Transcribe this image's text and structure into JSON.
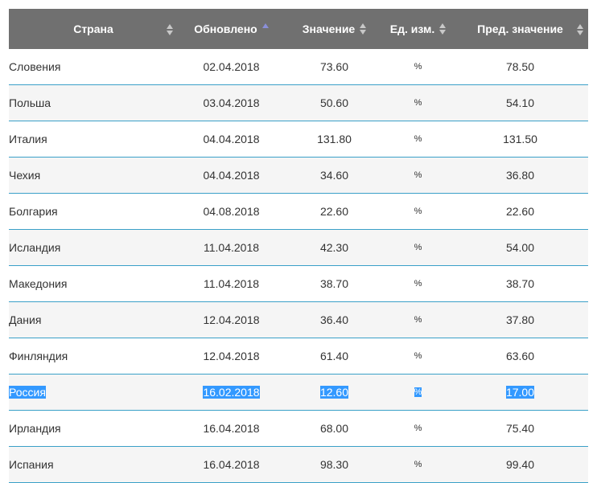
{
  "table": {
    "headers": [
      {
        "label": "Страна",
        "sort": "none"
      },
      {
        "label": "Обновлено",
        "sort": "asc"
      },
      {
        "label": "Значение",
        "sort": "none"
      },
      {
        "label": "Ед. изм.",
        "sort": "none"
      },
      {
        "label": "Пред. значение",
        "sort": "none"
      }
    ],
    "rows": [
      {
        "country": "Словения",
        "updated": "02.04.2018",
        "value": "73.60",
        "unit": "%",
        "prev": "78.50"
      },
      {
        "country": "Польша",
        "updated": "03.04.2018",
        "value": "50.60",
        "unit": "%",
        "prev": "54.10"
      },
      {
        "country": "Италия",
        "updated": "04.04.2018",
        "value": "131.80",
        "unit": "%",
        "prev": "131.50"
      },
      {
        "country": "Чехия",
        "updated": "04.04.2018",
        "value": "34.60",
        "unit": "%",
        "prev": "36.80"
      },
      {
        "country": "Болгария",
        "updated": "04.08.2018",
        "value": "22.60",
        "unit": "%",
        "prev": "22.60"
      },
      {
        "country": "Исландия",
        "updated": "11.04.2018",
        "value": "42.30",
        "unit": "%",
        "prev": "54.00"
      },
      {
        "country": "Македония",
        "updated": "11.04.2018",
        "value": "38.70",
        "unit": "%",
        "prev": "38.70"
      },
      {
        "country": "Дания",
        "updated": "12.04.2018",
        "value": "36.40",
        "unit": "%",
        "prev": "37.80"
      },
      {
        "country": "Финляндия",
        "updated": "12.04.2018",
        "value": "61.40",
        "unit": "%",
        "prev": "63.60"
      },
      {
        "country": "Россия",
        "updated": "16.02.2018",
        "value": "12.60",
        "unit": "%",
        "prev": "17.00",
        "selected": true
      },
      {
        "country": "Ирландия",
        "updated": "16.04.2018",
        "value": "68.00",
        "unit": "%",
        "prev": "75.40"
      },
      {
        "country": "Испания",
        "updated": "16.04.2018",
        "value": "98.30",
        "unit": "%",
        "prev": "99.40"
      }
    ]
  },
  "colors": {
    "header_bg": "#707070",
    "row_border": "#3aa0c8",
    "selection": "#3399ff",
    "sort_active": "#8a8fd8"
  },
  "icons": {
    "sort": "sort-arrows-icon",
    "sort_asc": "sort-asc-icon"
  }
}
